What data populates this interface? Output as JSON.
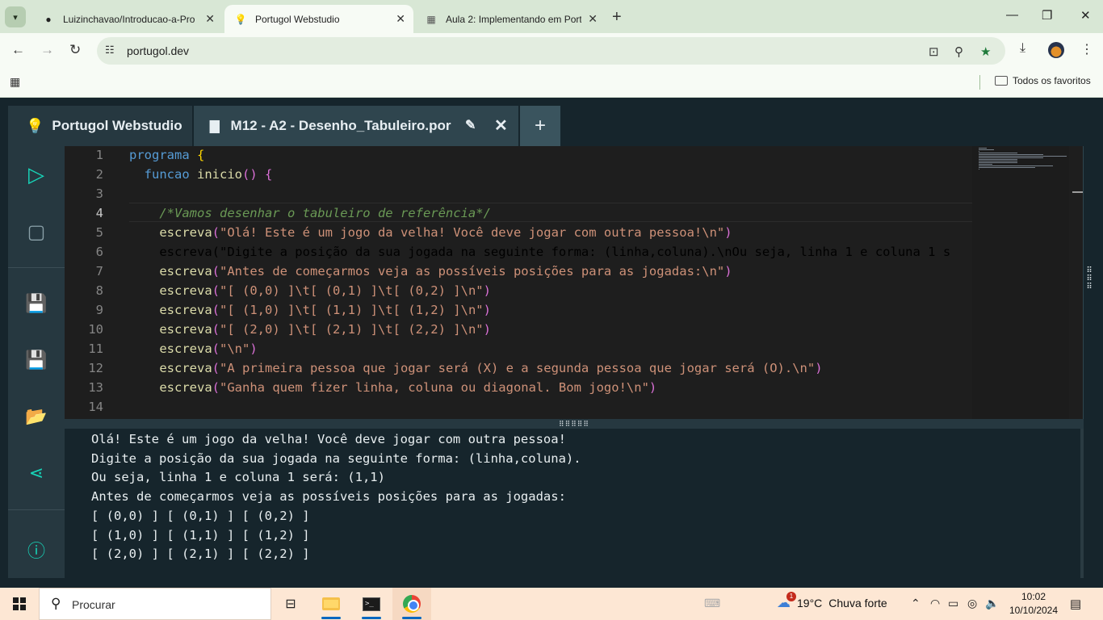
{
  "browser": {
    "tabs": [
      {
        "title": "Luizinchavao/Introducao-a-Pro",
        "icon": "github-icon",
        "active": false
      },
      {
        "title": "Portugol Webstudio",
        "icon": "lightbulb-icon",
        "active": true
      },
      {
        "title": "Aula 2: Implementando em Port",
        "icon": "course-icon",
        "active": false
      }
    ],
    "url": "portugol.dev",
    "bookmarks_all": "Todos os favoritos"
  },
  "app": {
    "home_tab": "Portugol Webstudio",
    "file_tab": "M12 - A2 - Desenho_Tabuleiro.por",
    "current_line": 4
  },
  "editor": {
    "lines": [
      {
        "num": "1",
        "text": "programa {"
      },
      {
        "num": "2",
        "text": "  funcao inicio() {"
      },
      {
        "num": "3",
        "text": ""
      },
      {
        "num": "4",
        "text": "    /*Vamos desenhar o tabuleiro de referência*/"
      },
      {
        "num": "5",
        "text": "    escreva(\"Olá! Este é um jogo da velha! Você deve jogar com outra pessoa!\\n\")"
      },
      {
        "num": "6",
        "text": "    escreva(\"Digite a posição da sua jogada na seguinte forma: (linha,coluna).\\nOu seja, linha 1 e coluna 1 s"
      },
      {
        "num": "7",
        "text": "    escreva(\"Antes de começarmos veja as possíveis posições para as jogadas:\\n\")"
      },
      {
        "num": "8",
        "text": "    escreva(\"[ (0,0) ]\\t[ (0,1) ]\\t[ (0,2) ]\\n\")"
      },
      {
        "num": "9",
        "text": "    escreva(\"[ (1,0) ]\\t[ (1,1) ]\\t[ (1,2) ]\\n\")"
      },
      {
        "num": "10",
        "text": "    escreva(\"[ (2,0) ]\\t[ (2,1) ]\\t[ (2,2) ]\\n\")"
      },
      {
        "num": "11",
        "text": "    escreva(\"\\n\")"
      },
      {
        "num": "12",
        "text": "    escreva(\"A primeira pessoa que jogar será (X) e a segunda pessoa que jogar será (O).\\n\")"
      },
      {
        "num": "13",
        "text": "    escreva(\"Ganha quem fizer linha, coluna ou diagonal. Bom jogo!\\n\")"
      },
      {
        "num": "14",
        "text": ""
      }
    ]
  },
  "console": {
    "lines": [
      "Olá! Este é um jogo da velha! Você deve jogar com outra pessoa!",
      "Digite a posição da sua jogada na seguinte forma: (linha,coluna).",
      "Ou seja, linha 1 e coluna 1 será: (1,1)",
      "Antes de começarmos veja as possíveis posições para as jogadas:",
      "[ (0,0) ] [ (0,1) ] [ (0,2) ]",
      "[ (1,0) ] [ (1,1) ] [ (1,2) ]",
      "[ (2,0) ] [ (2,1) ] [ (2,2) ]"
    ]
  },
  "taskbar": {
    "search_placeholder": "Procurar",
    "weather_badge": "1",
    "temperature": "19°C",
    "weather_text": "Chuva forte",
    "time": "10:02",
    "date": "10/10/2024"
  },
  "colors": {
    "accent": "#17d4b8",
    "keyword": "#569cd6",
    "string": "#ce9178",
    "comment": "#6a9955",
    "function": "#dcdcaa"
  }
}
